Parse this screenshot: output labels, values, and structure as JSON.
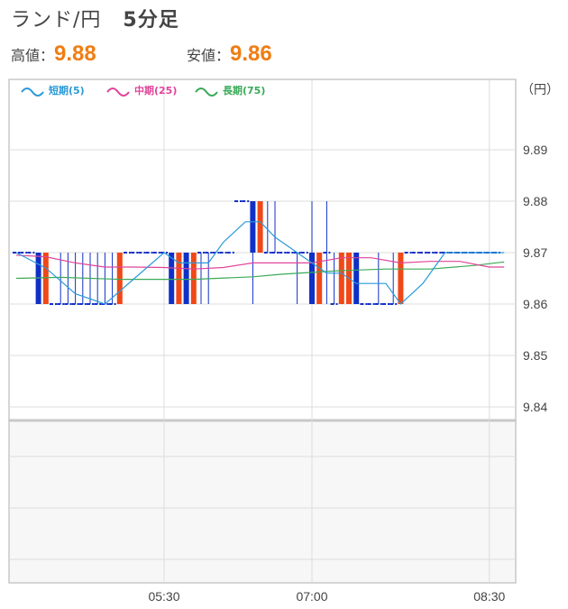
{
  "header": {
    "pair": "ランド/円",
    "timeframe": "5分足",
    "high_label": "高値：",
    "high_value": "9.88",
    "low_label": "安値：",
    "low_value": "9.86"
  },
  "chart_data": {
    "type": "candlestick",
    "unit_label": "（円）",
    "y_ticks": [
      "9.89",
      "9.88",
      "9.87",
      "9.86",
      "9.85",
      "9.84"
    ],
    "ylim": [
      9.835,
      9.9
    ],
    "x_ticks": [
      {
        "label": "05:30",
        "bar_index": 20
      },
      {
        "label": "07:00",
        "bar_index": 40
      },
      {
        "label": "08:30",
        "bar_index": 64
      }
    ],
    "grid": true,
    "legend_position": "top-left",
    "colors": {
      "up": "#1030c8",
      "down": "#f04818",
      "sma5": "#2a9ad8",
      "sma25": "#e0449a",
      "sma75": "#3aaa58"
    },
    "legend": [
      {
        "key": "sma5",
        "label": "短期(5)"
      },
      {
        "key": "sma25",
        "label": "中期(25)"
      },
      {
        "key": "sma75",
        "label": "長期(75)"
      }
    ],
    "candles": [
      [
        9.87,
        9.87,
        9.87,
        9.87
      ],
      [
        9.87,
        9.87,
        9.87,
        9.87
      ],
      [
        9.87,
        9.87,
        9.87,
        9.87
      ],
      [
        9.86,
        9.87,
        9.86,
        9.87
      ],
      [
        9.87,
        9.87,
        9.86,
        9.86
      ],
      [
        9.86,
        9.86,
        9.86,
        9.86
      ],
      [
        9.86,
        9.87,
        9.86,
        9.86
      ],
      [
        9.86,
        9.87,
        9.86,
        9.86
      ],
      [
        9.86,
        9.87,
        9.86,
        9.86
      ],
      [
        9.86,
        9.87,
        9.86,
        9.86
      ],
      [
        9.86,
        9.87,
        9.86,
        9.86
      ],
      [
        9.86,
        9.87,
        9.86,
        9.86
      ],
      [
        9.86,
        9.87,
        9.86,
        9.86
      ],
      [
        9.86,
        9.87,
        9.86,
        9.86
      ],
      [
        9.87,
        9.87,
        9.86,
        9.86
      ],
      [
        9.87,
        9.87,
        9.87,
        9.87
      ],
      [
        9.87,
        9.87,
        9.87,
        9.87
      ],
      [
        9.87,
        9.87,
        9.87,
        9.87
      ],
      [
        9.87,
        9.87,
        9.87,
        9.87
      ],
      [
        9.87,
        9.87,
        9.87,
        9.87
      ],
      [
        9.87,
        9.87,
        9.87,
        9.87
      ],
      [
        9.86,
        9.87,
        9.86,
        9.87
      ],
      [
        9.87,
        9.87,
        9.86,
        9.86
      ],
      [
        9.86,
        9.87,
        9.86,
        9.87
      ],
      [
        9.87,
        9.87,
        9.86,
        9.86
      ],
      [
        9.87,
        9.87,
        9.86,
        9.87
      ],
      [
        9.87,
        9.87,
        9.86,
        9.87
      ],
      [
        9.87,
        9.87,
        9.87,
        9.87
      ],
      [
        9.87,
        9.87,
        9.87,
        9.87
      ],
      [
        9.87,
        9.87,
        9.87,
        9.87
      ],
      [
        9.88,
        9.88,
        9.88,
        9.88
      ],
      [
        9.88,
        9.88,
        9.88,
        9.88
      ],
      [
        9.87,
        9.88,
        9.86,
        9.88
      ],
      [
        9.88,
        9.88,
        9.87,
        9.87
      ],
      [
        9.87,
        9.88,
        9.87,
        9.87
      ],
      [
        9.87,
        9.88,
        9.87,
        9.87
      ],
      [
        9.87,
        9.87,
        9.87,
        9.87
      ],
      [
        9.87,
        9.87,
        9.87,
        9.87
      ],
      [
        9.87,
        9.87,
        9.86,
        9.87
      ],
      [
        9.87,
        9.87,
        9.87,
        9.87
      ],
      [
        9.86,
        9.88,
        9.86,
        9.87
      ],
      [
        9.87,
        9.87,
        9.86,
        9.86
      ],
      [
        9.87,
        9.88,
        9.86,
        9.87
      ],
      [
        9.86,
        9.87,
        9.86,
        9.86
      ],
      [
        9.87,
        9.87,
        9.86,
        9.86
      ],
      [
        9.87,
        9.87,
        9.86,
        9.86
      ],
      [
        9.86,
        9.87,
        9.86,
        9.87
      ],
      [
        9.86,
        9.86,
        9.86,
        9.86
      ],
      [
        9.86,
        9.86,
        9.86,
        9.86
      ],
      [
        9.86,
        9.87,
        9.86,
        9.86
      ],
      [
        9.86,
        9.86,
        9.86,
        9.86
      ],
      [
        9.86,
        9.87,
        9.86,
        9.86
      ],
      [
        9.87,
        9.87,
        9.86,
        9.86
      ],
      [
        9.87,
        9.87,
        9.87,
        9.87
      ],
      [
        9.87,
        9.87,
        9.87,
        9.87
      ],
      [
        9.87,
        9.87,
        9.87,
        9.87
      ],
      [
        9.87,
        9.87,
        9.87,
        9.87
      ],
      [
        9.87,
        9.87,
        9.87,
        9.87
      ],
      [
        9.87,
        9.87,
        9.87,
        9.87
      ],
      [
        9.87,
        9.87,
        9.87,
        9.87
      ],
      [
        9.87,
        9.87,
        9.87,
        9.87
      ],
      [
        9.87,
        9.87,
        9.87,
        9.87
      ],
      [
        9.87,
        9.87,
        9.87,
        9.87
      ],
      [
        9.87,
        9.87,
        9.87,
        9.87
      ],
      [
        9.87,
        9.87,
        9.87,
        9.87
      ],
      [
        9.87,
        9.87,
        9.87,
        9.87
      ]
    ],
    "sma5": [
      [
        0,
        9.87
      ],
      [
        4,
        9.867
      ],
      [
        8,
        9.862
      ],
      [
        12,
        9.86
      ],
      [
        16,
        9.865
      ],
      [
        20,
        9.87
      ],
      [
        22,
        9.868
      ],
      [
        26,
        9.868
      ],
      [
        28,
        9.872
      ],
      [
        31,
        9.876
      ],
      [
        33,
        9.876
      ],
      [
        35,
        9.873
      ],
      [
        38,
        9.87
      ],
      [
        40,
        9.868
      ],
      [
        42,
        9.866
      ],
      [
        44,
        9.866
      ],
      [
        46,
        9.864
      ],
      [
        50,
        9.864
      ],
      [
        52,
        9.86
      ],
      [
        55,
        9.864
      ],
      [
        58,
        9.87
      ],
      [
        62,
        9.87
      ],
      [
        66,
        9.87
      ]
    ],
    "sma25": [
      [
        0,
        9.8695
      ],
      [
        4,
        9.8692
      ],
      [
        8,
        9.868
      ],
      [
        12,
        9.8672
      ],
      [
        16,
        9.8672
      ],
      [
        20,
        9.8671
      ],
      [
        24,
        9.8668
      ],
      [
        28,
        9.8671
      ],
      [
        32,
        9.868
      ],
      [
        36,
        9.868
      ],
      [
        40,
        9.868
      ],
      [
        44,
        9.869
      ],
      [
        48,
        9.869
      ],
      [
        52,
        9.868
      ],
      [
        56,
        9.8683
      ],
      [
        60,
        9.8683
      ],
      [
        64,
        9.8672
      ],
      [
        66,
        9.8672
      ]
    ],
    "sma75": [
      [
        0,
        9.865
      ],
      [
        6,
        9.8652
      ],
      [
        14,
        9.8648
      ],
      [
        24,
        9.8648
      ],
      [
        32,
        9.8653
      ],
      [
        36,
        9.8658
      ],
      [
        44,
        9.8665
      ],
      [
        50,
        9.8668
      ],
      [
        56,
        9.8668
      ],
      [
        62,
        9.8675
      ],
      [
        66,
        9.8682
      ]
    ]
  }
}
